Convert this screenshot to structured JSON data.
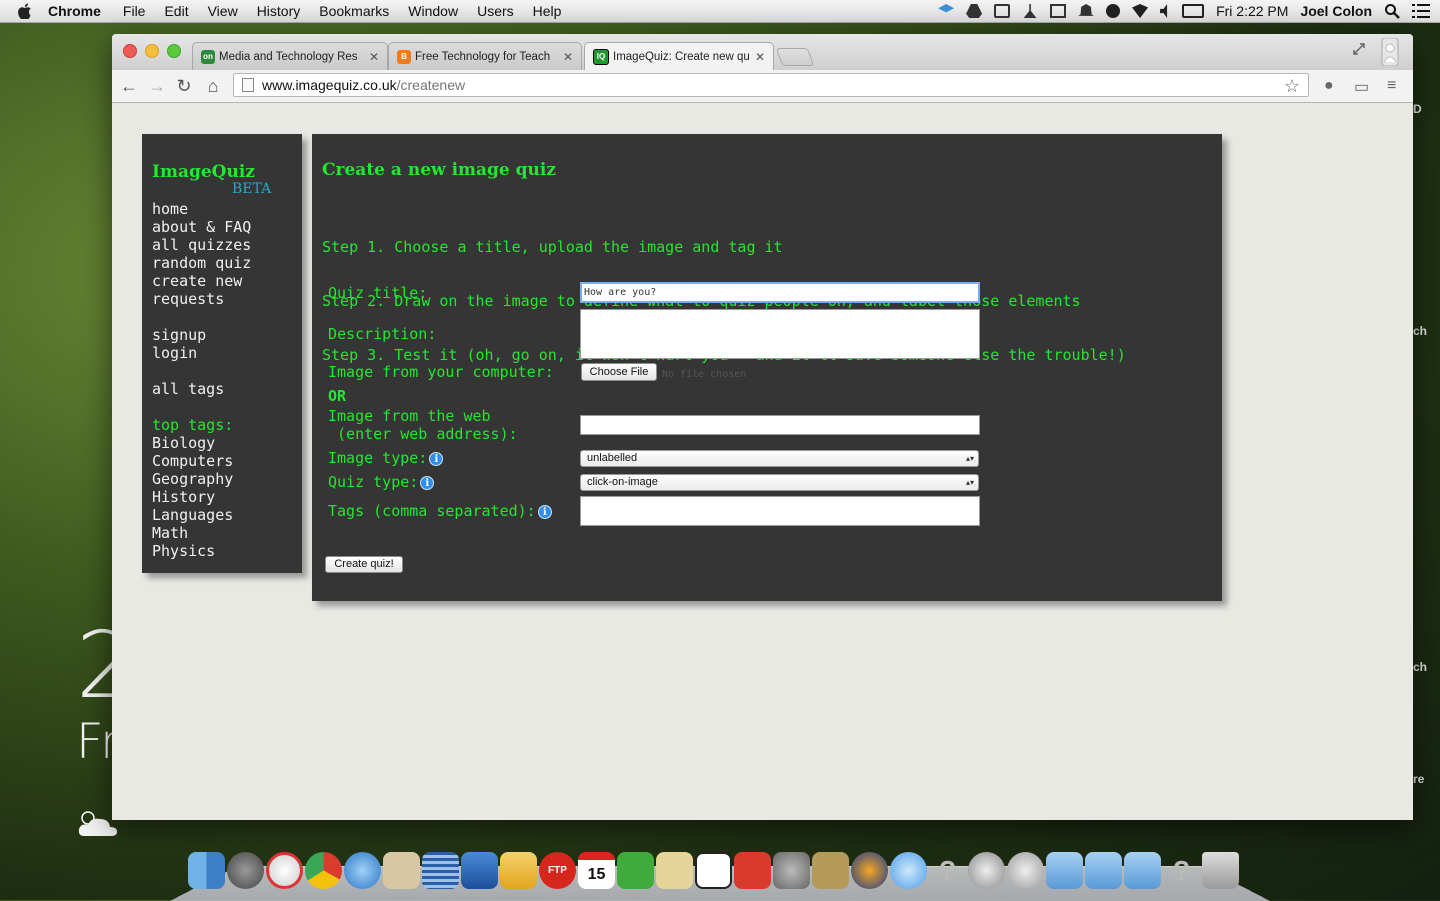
{
  "menubar": {
    "app": "Chrome",
    "items": [
      "File",
      "Edit",
      "View",
      "History",
      "Bookmarks",
      "Window",
      "Users",
      "Help"
    ],
    "clock": "Fri 2:22 PM",
    "user": "Joel Colon"
  },
  "desktop": {
    "widget_day_number": "2",
    "widget_day": "Fr",
    "right_labels": [
      "D",
      "ch",
      "ch",
      "re"
    ]
  },
  "tabs": [
    {
      "title": "Media and Technology Res",
      "favicon_text": "on",
      "favicon_color": "#2e8a3a"
    },
    {
      "title": "Free Technology for Teach",
      "favicon_text": "B",
      "favicon_color": "#f07b1f"
    },
    {
      "title": "ImageQuiz: Create new qu",
      "favicon_text": "IQ",
      "favicon_color": "#1d9a2b",
      "active": true
    }
  ],
  "address": {
    "host": "www.imagequiz.co.uk",
    "path": "/createnew"
  },
  "site": {
    "logo": "ImageQuiz",
    "beta": "BETA",
    "nav": [
      "home",
      "about & FAQ",
      "all quizzes",
      "random quiz",
      "create new",
      "requests"
    ],
    "account": [
      "signup",
      "login"
    ],
    "all_tags": "all tags",
    "top_tags_heading": "top tags:",
    "top_tags": [
      "Biology",
      "Computers",
      "Geography",
      "History",
      "Languages",
      "Math",
      "Physics"
    ]
  },
  "form": {
    "heading": "Create a new image quiz",
    "steps": [
      "Step 1. Choose a title, upload the image and tag it",
      "Step 2. Draw on the image to define what to quiz people on, and label those elements",
      "Step 3. Test it (oh, go on, it won't hurt you - and it'll save someone else the trouble!)"
    ],
    "quiz_title_label": "Quiz title:",
    "quiz_title_value": "How are you?",
    "description_label": "Description:",
    "image_computer_label": "Image from your computer:",
    "choose_file": "Choose File",
    "no_file": "No file chosen",
    "or": "OR",
    "image_web_label_1": "Image from the web",
    "image_web_label_2": " (enter web address):",
    "image_type_label": "Image type:",
    "image_type_value": "unlabelled",
    "quiz_type_label": "Quiz type:",
    "quiz_type_value": "click-on-image",
    "tags_label": "Tags (comma separated):",
    "submit": "Create quiz!"
  },
  "dock": {
    "icons": [
      "finder-icon",
      "launchpad-icon",
      "photo-icon",
      "chrome-icon",
      "safari-icon",
      "app-icon",
      "notes-icon",
      "keynote-icon",
      "pages-icon",
      "ftp-icon",
      "calendar-icon",
      "evernote-icon",
      "textedit-icon",
      "pencil-icon",
      "presentation-icon",
      "system-preferences-icon",
      "utility-icon",
      "audacity-icon",
      "messages-icon",
      "help-icon",
      "disk-icon",
      "mail-icon",
      "folder-icon",
      "folder-icon",
      "folder-icon",
      "help-icon",
      "trash-icon"
    ],
    "calendar_date": "15",
    "ftp_label": "FTP"
  }
}
